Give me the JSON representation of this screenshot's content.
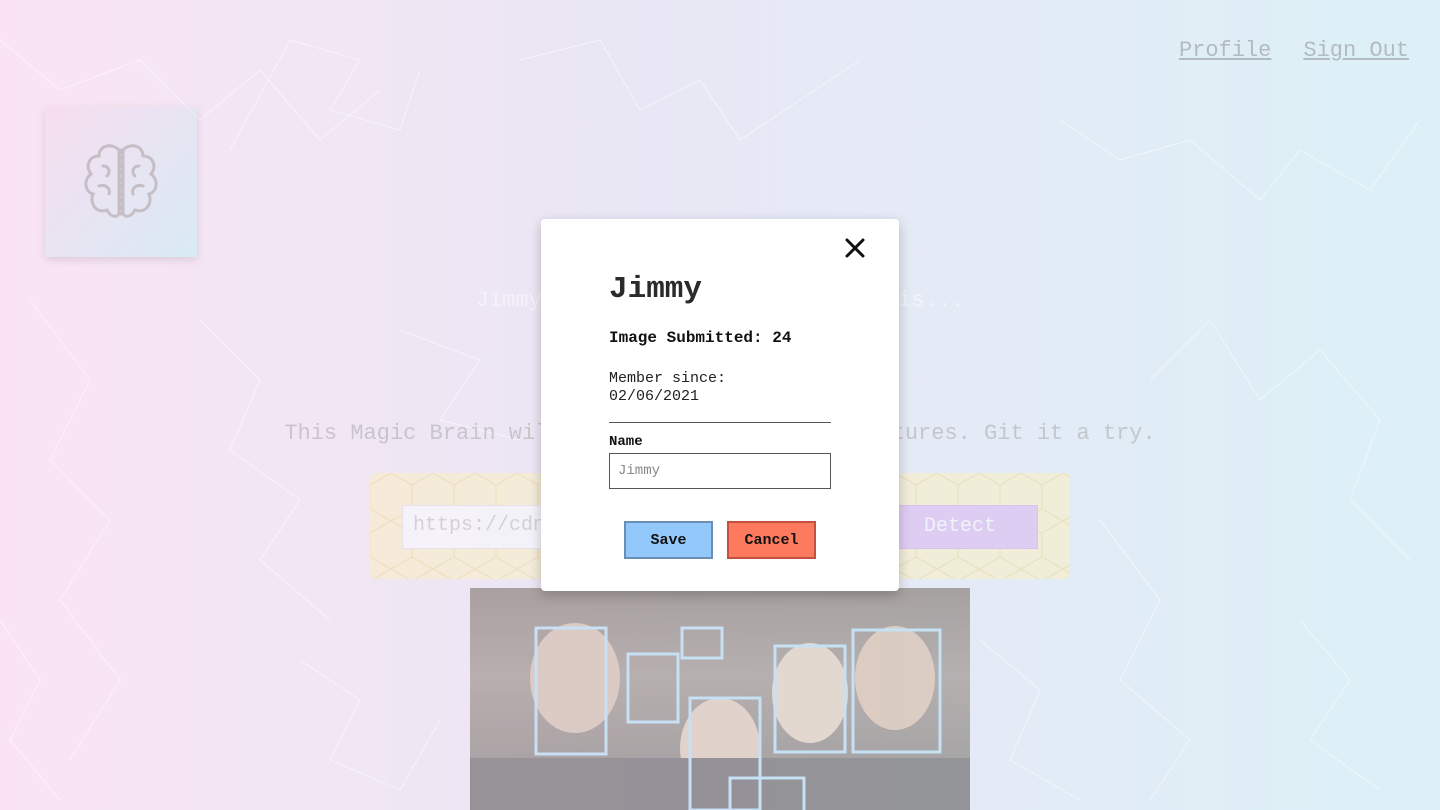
{
  "nav": {
    "profile": "Profile",
    "sign_out": "Sign Out"
  },
  "logo": {
    "icon": "brain-icon"
  },
  "greeting": "Jimmy, your current entry count is...",
  "tagline": "This Magic Brain will detect faces in your pictures. Git it a try.",
  "image_form": {
    "url_placeholder": "https://cdn...",
    "detect_label": "Detect"
  },
  "photo": {
    "face_boxes_count": 7
  },
  "profile_modal": {
    "close_icon": "close-icon",
    "name": "Jimmy",
    "images_submitted_label": "Image Submitted: 24",
    "member_since_label": "Member since:",
    "member_since_date": "02/06/2021",
    "name_field_label": "Name",
    "name_placeholder": "Jimmy",
    "save_label": "Save",
    "cancel_label": "Cancel"
  },
  "colors": {
    "save_button": "#93c8fa",
    "cancel_button": "#fd7a5e",
    "detect_button": "#d7a8f0",
    "form_panel": "#fff0b8"
  }
}
